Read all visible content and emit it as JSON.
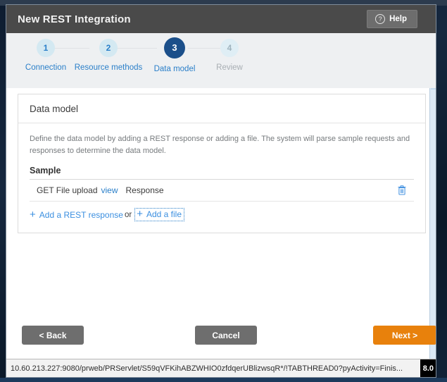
{
  "window": {
    "title": "New REST Integration",
    "help_label": "Help",
    "help_icon": "question-circle-icon"
  },
  "steps": [
    {
      "number": "1",
      "label": "Connection",
      "state": "done"
    },
    {
      "number": "2",
      "label": "Resource methods",
      "state": "done"
    },
    {
      "number": "3",
      "label": "Data model",
      "state": "active"
    },
    {
      "number": "4",
      "label": "Review",
      "state": "muted"
    }
  ],
  "card": {
    "title": "Data model",
    "description": "Define the data model by adding a REST response or adding a file. The system will parse sample requests and responses to determine the data model.",
    "sample_heading": "Sample",
    "rows": [
      {
        "method_and_name": "GET File upload",
        "view_label": "view",
        "type_label": "Response",
        "delete_icon": "trash-icon"
      }
    ],
    "add_rest_response_label": "Add a REST response",
    "or_label": "or",
    "add_file_label": "Add a file",
    "plus_icon": "plus-icon"
  },
  "footer": {
    "back_label": "< Back",
    "cancel_label": "Cancel",
    "next_label": "Next >"
  },
  "status_bar": {
    "url": "10.60.213.227:9080/prweb/PRServlet/S59qVFKihABZWHIO0zfdqerUBlizwsqR*/!TABTHREAD0?pyActivity=Finis...",
    "zoom_badge": "8.0"
  },
  "colors": {
    "header_bg": "#4a4a4a",
    "accent_blue": "#2a7fc9",
    "active_step": "#1b4f8a",
    "next_orange": "#e8810c",
    "button_grey": "#6e6e6e"
  }
}
